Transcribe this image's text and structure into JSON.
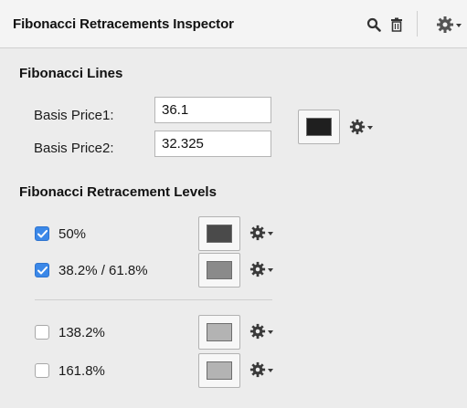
{
  "inspector": {
    "title": "Fibonacci Retracements Inspector",
    "actions": [
      "search-icon",
      "trash-icon",
      "gear-menu-icon"
    ]
  },
  "fib_lines": {
    "heading": "Fibonacci Lines",
    "basis1_label": "Basis Price1:",
    "basis1_value": "36.1",
    "basis2_label": "Basis Price2:",
    "basis2_value": "32.325",
    "line_color": "#1f1f1f"
  },
  "levels": {
    "heading": "Fibonacci Retracement Levels",
    "items": [
      {
        "label": "50%",
        "checked": true,
        "color": "#4a4a4a"
      },
      {
        "label": "38.2% / 61.8%",
        "checked": true,
        "color": "#8a8a8a"
      },
      {
        "label": "138.2%",
        "checked": false,
        "color": "#b3b3b3"
      },
      {
        "label": "161.8%",
        "checked": false,
        "color": "#b3b3b3"
      }
    ]
  },
  "colors": {
    "checkbox_on": "#3b88e8",
    "panel_bg": "#ececec"
  }
}
